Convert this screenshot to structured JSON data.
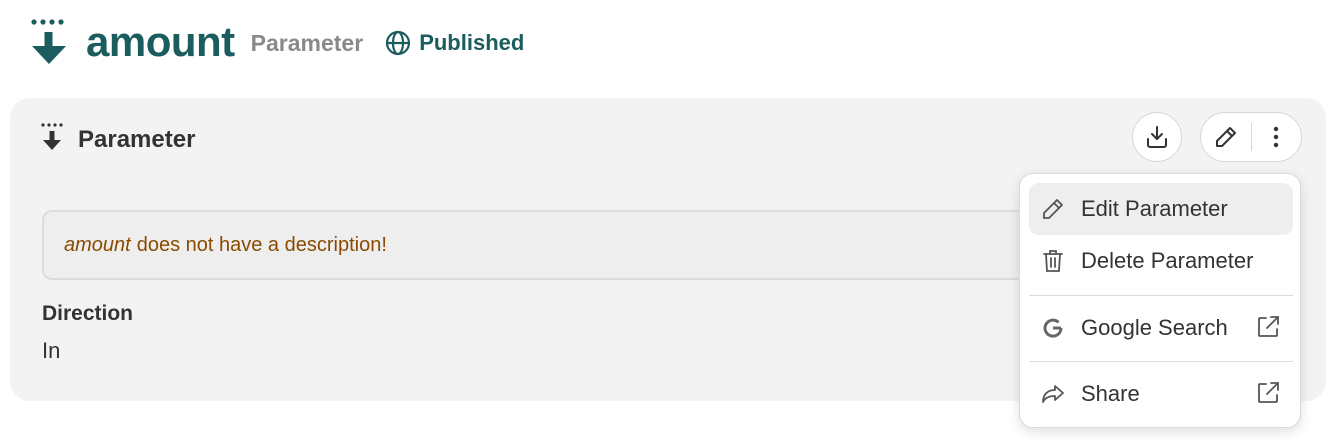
{
  "header": {
    "title": "amount",
    "type_label": "Parameter",
    "status": "Published",
    "icon": "parameter-in-icon",
    "status_icon": "globe-icon"
  },
  "card": {
    "title": "Parameter",
    "icon": "parameter-in-icon",
    "actions": {
      "download_icon": "download-icon",
      "edit_icon": "pencil-icon",
      "more_icon": "more-vertical-icon"
    },
    "description": {
      "name": "amount",
      "message": "does not have a description!"
    },
    "direction": {
      "label": "Direction",
      "value": "In"
    }
  },
  "menu": {
    "items": [
      {
        "label": "Edit Parameter",
        "icon": "pencil-icon"
      },
      {
        "label": "Delete Parameter",
        "icon": "trash-icon"
      },
      {
        "label": "Google Search",
        "icon": "google-icon",
        "trailing_icon": "external-link-icon"
      },
      {
        "label": "Share",
        "icon": "share-icon",
        "trailing_icon": "external-link-icon"
      }
    ]
  },
  "colors": {
    "brand": "#1b5c5e",
    "warning_text": "#8a4b00",
    "card_bg": "#f3f3f3"
  }
}
